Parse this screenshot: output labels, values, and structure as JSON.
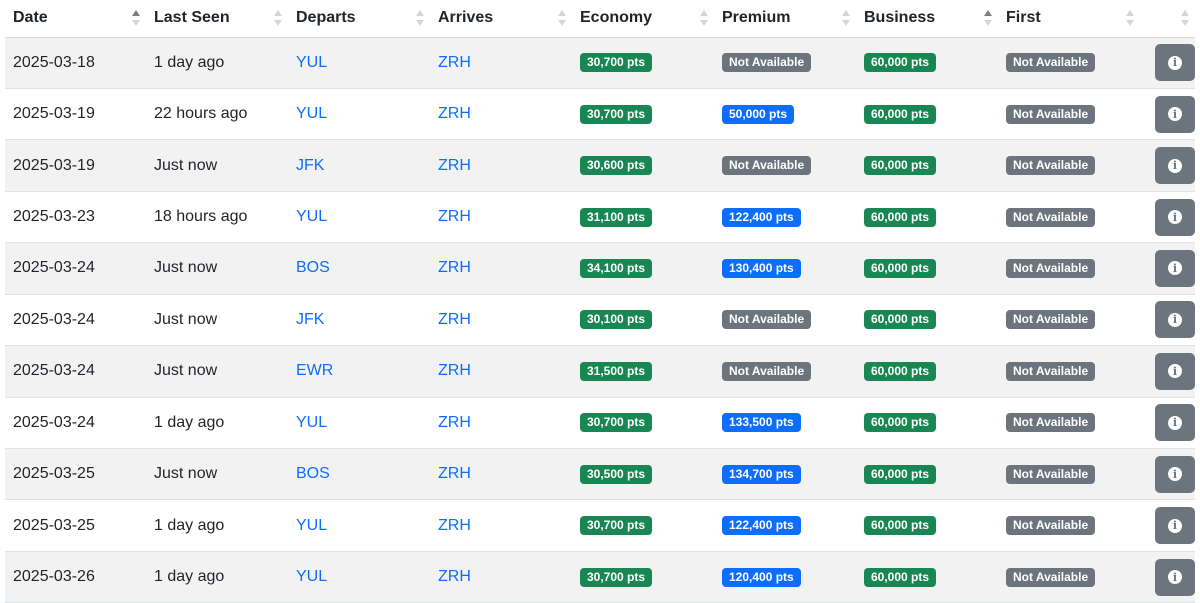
{
  "columns": [
    {
      "label": "Date",
      "sort_active": true
    },
    {
      "label": "Last Seen",
      "sort_active": false
    },
    {
      "label": "Departs",
      "sort_active": false
    },
    {
      "label": "Arrives",
      "sort_active": false
    },
    {
      "label": "Economy",
      "sort_active": false
    },
    {
      "label": "Premium",
      "sort_active": false
    },
    {
      "label": "Business",
      "sort_active": true
    },
    {
      "label": "First",
      "sort_active": false
    },
    {
      "label": "",
      "sort_active": false
    }
  ],
  "colors": {
    "available": "#198754",
    "premium_available": "#0d6efd",
    "not_available": "#6c757d",
    "link": "#0d6efd"
  },
  "rows": [
    {
      "date": "2025-03-18",
      "last_seen": "1 day ago",
      "departs": "YUL",
      "arrives": "ZRH",
      "economy": "30,700 pts",
      "premium": "Not Available",
      "business": "60,000 pts",
      "first": "Not Available"
    },
    {
      "date": "2025-03-19",
      "last_seen": "22 hours ago",
      "departs": "YUL",
      "arrives": "ZRH",
      "economy": "30,700 pts",
      "premium": "50,000 pts",
      "business": "60,000 pts",
      "first": "Not Available"
    },
    {
      "date": "2025-03-19",
      "last_seen": "Just now",
      "departs": "JFK",
      "arrives": "ZRH",
      "economy": "30,600 pts",
      "premium": "Not Available",
      "business": "60,000 pts",
      "first": "Not Available"
    },
    {
      "date": "2025-03-23",
      "last_seen": "18 hours ago",
      "departs": "YUL",
      "arrives": "ZRH",
      "economy": "31,100 pts",
      "premium": "122,400 pts",
      "business": "60,000 pts",
      "first": "Not Available"
    },
    {
      "date": "2025-03-24",
      "last_seen": "Just now",
      "departs": "BOS",
      "arrives": "ZRH",
      "economy": "34,100 pts",
      "premium": "130,400 pts",
      "business": "60,000 pts",
      "first": "Not Available"
    },
    {
      "date": "2025-03-24",
      "last_seen": "Just now",
      "departs": "JFK",
      "arrives": "ZRH",
      "economy": "30,100 pts",
      "premium": "Not Available",
      "business": "60,000 pts",
      "first": "Not Available"
    },
    {
      "date": "2025-03-24",
      "last_seen": "Just now",
      "departs": "EWR",
      "arrives": "ZRH",
      "economy": "31,500 pts",
      "premium": "Not Available",
      "business": "60,000 pts",
      "first": "Not Available"
    },
    {
      "date": "2025-03-24",
      "last_seen": "1 day ago",
      "departs": "YUL",
      "arrives": "ZRH",
      "economy": "30,700 pts",
      "premium": "133,500 pts",
      "business": "60,000 pts",
      "first": "Not Available"
    },
    {
      "date": "2025-03-25",
      "last_seen": "Just now",
      "departs": "BOS",
      "arrives": "ZRH",
      "economy": "30,500 pts",
      "premium": "134,700 pts",
      "business": "60,000 pts",
      "first": "Not Available"
    },
    {
      "date": "2025-03-25",
      "last_seen": "1 day ago",
      "departs": "YUL",
      "arrives": "ZRH",
      "economy": "30,700 pts",
      "premium": "122,400 pts",
      "business": "60,000 pts",
      "first": "Not Available"
    },
    {
      "date": "2025-03-26",
      "last_seen": "1 day ago",
      "departs": "YUL",
      "arrives": "ZRH",
      "economy": "30,700 pts",
      "premium": "120,400 pts",
      "business": "60,000 pts",
      "first": "Not Available"
    }
  ],
  "info_icon": "info-icon"
}
